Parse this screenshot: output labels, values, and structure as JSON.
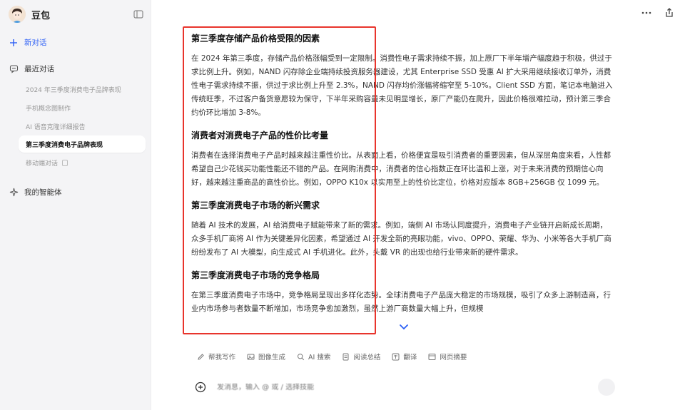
{
  "sidebar": {
    "app_name": "豆包",
    "new_chat": "新对话",
    "recent_label": "最近对话",
    "history": [
      {
        "label": "2024 年三季度消费电子品牌表现"
      },
      {
        "label": "手机概念图制作"
      },
      {
        "label": "AI 语音克隆详细报告"
      },
      {
        "label": "第三季度消费电子品牌表现"
      },
      {
        "label": "移动端对话"
      }
    ],
    "agents_label": "我的智能体"
  },
  "content": {
    "sections": [
      {
        "title": "第三季度存储产品价格受限的因素",
        "body": "在 2024 年第三季度，存储产品价格涨幅受到一定限制。消费性电子需求持续不振，加上原厂下半年增产幅度趋于积极，供过于求比例上升。例如，NAND 闪存除企业端持续投资服务器建设，尤其 Enterprise SSD 受惠 AI 扩大采用继续接收订单外，消费性电子需求持续不振，供过于求比例上升至 2.3%，NAND 闪存均价涨幅将缩窄至 5-10%。Client SSD 方面，笔记本电脑进入传统旺季，不过客户备货意愿较为保守，下半年采购容量未见明显增长，原厂产能仍在爬升，因此价格很难拉动，预计第三季合约价环比增加 3-8%。"
      },
      {
        "title": "消费者对消费电子产品的性价比考量",
        "body": "消费者在选择消费电子产品时越来越注重性价比。从表面上看，价格便宜是吸引消费者的重要因素，但从深层角度来看，人性都希望自己少花钱买功能性能还不错的产品。在网购消费中，消费者的信心指数正在环比温和上涨，对于未来消费的预期信心向好，越来越注重商品的高性价比。例如，OPPO K10x 以实用至上的性价比定位，价格对应版本 8GB+256GB 仅 1099 元。"
      },
      {
        "title": "第三季度消费电子市场的新兴需求",
        "body": "随着 AI 技术的发展，AI 给消费电子赋能带来了新的需求。例如，端侧 AI 市场认同度提升，消费电子产业链开启新成长周期，众多手机厂商将 AI 作为关键差异化因素，希望通过 AI 开发全新的亮眼功能，vivo、OPPO、荣耀、华为、小米等各大手机厂商纷纷发布了 AI 大模型，向生成式 AI 手机进化。此外，头戴 VR 的出现也给行业带来新的硬件需求。"
      },
      {
        "title": "第三季度消费电子市场的竞争格局",
        "body": "在第三季度消费电子市场中，竞争格局呈现出多样化态势。全球消费电子产品庞大稳定的市场规模，吸引了众多上游制造商，行业内市场参与者数量不断增加，市场竞争愈加激烈，虽然上游厂商数量大幅上升，但规模"
      }
    ]
  },
  "toolbar": {
    "tools": [
      "帮我写作",
      "图像生成",
      "AI 搜索",
      "阅读总结",
      "翻译",
      "网页摘要"
    ]
  },
  "input": {
    "placeholder": "发消息，输入 @ 或 / 选择技能"
  },
  "colors": {
    "accent": "#2b5ef5",
    "highlight": "#e8342c",
    "sidebar_bg": "#f4f4f6"
  }
}
